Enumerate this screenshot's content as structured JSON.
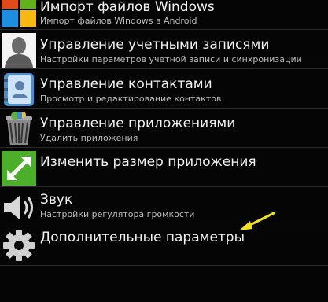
{
  "settings": {
    "items": [
      {
        "title": "Импорт файлов Windows",
        "subtitle": "Импорт файлов Windows в Android",
        "icon": "windows-logo-icon"
      },
      {
        "title": "Управление учетными записями",
        "subtitle": "Настройки параметров учетной записи и синхронизации",
        "icon": "user-account-icon"
      },
      {
        "title": "Управление контактами",
        "subtitle": "Просмотр и редактирование контактов",
        "icon": "contacts-book-icon"
      },
      {
        "title": "Управление приложениями",
        "subtitle": "Удалить приложения",
        "icon": "trash-bin-icon"
      },
      {
        "title": "Изменить размер приложения",
        "subtitle": "",
        "icon": "resize-arrows-icon"
      },
      {
        "title": "Звук",
        "subtitle": "Настройки регулятора громкости",
        "icon": "speaker-icon"
      },
      {
        "title": "Дополнительные параметры",
        "subtitle": "",
        "icon": "gear-icon"
      }
    ]
  },
  "colors": {
    "background": "#050505",
    "accent_green": "#4caf2a",
    "annotation_arrow": "#f2e21a"
  }
}
